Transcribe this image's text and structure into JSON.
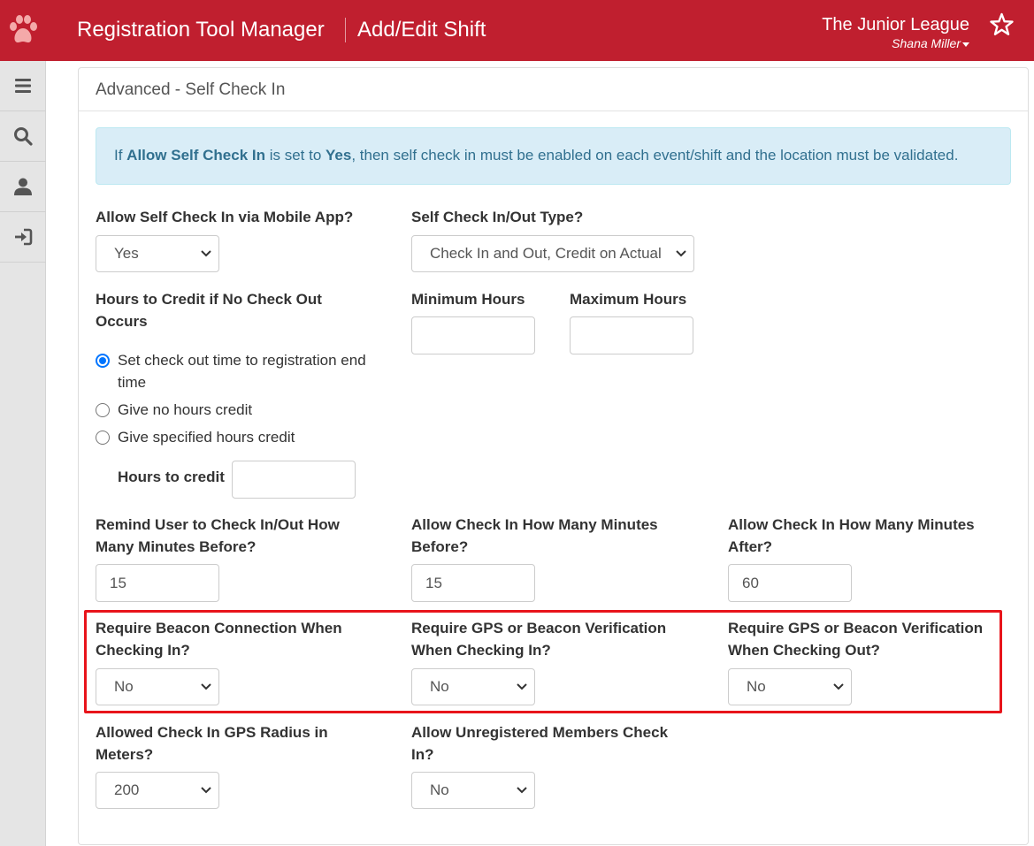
{
  "header": {
    "app_title": "Registration Tool Manager",
    "page_title": "Add/Edit Shift",
    "org_name": "The Junior League",
    "user_name": "Shana Miller",
    "brand_color": "#c01f2f",
    "logo_icon": "paw-icon",
    "favorite_icon": "star-icon"
  },
  "sidebar": {
    "items": [
      {
        "icon": "menu-icon"
      },
      {
        "icon": "search-icon"
      },
      {
        "icon": "user-icon"
      },
      {
        "icon": "sign-in-icon"
      }
    ]
  },
  "panel": {
    "title": "Advanced - Self Check In"
  },
  "alert": {
    "prefix": "If ",
    "strong1": "Allow Self Check In",
    "mid": " is set to ",
    "strong2": "Yes",
    "suffix": ", then self check in must be enabled on each event/shift and the location must be validated."
  },
  "form": {
    "allow_self_check_in": {
      "label": "Allow Self Check In via Mobile App?",
      "value": "Yes"
    },
    "check_type": {
      "label": "Self Check In/Out Type?",
      "value": "Check In and Out, Credit on Actual"
    },
    "hours_if_no_checkout": {
      "label": "Hours to Credit if No Check Out Occurs",
      "options": [
        {
          "label": "Set check out time to registration end time",
          "checked": true
        },
        {
          "label": "Give no hours credit",
          "checked": false
        },
        {
          "label": "Give specified hours credit",
          "checked": false
        }
      ],
      "hours_to_credit_label": "Hours to credit",
      "hours_to_credit_value": ""
    },
    "minimum_hours": {
      "label": "Minimum Hours",
      "value": ""
    },
    "maximum_hours": {
      "label": "Maximum Hours",
      "value": ""
    },
    "remind_minutes": {
      "label": "Remind User to Check In/Out How Many Minutes Before?",
      "value": "15"
    },
    "allow_minutes_before": {
      "label": "Allow Check In How Many Minutes Before?",
      "value": "15"
    },
    "allow_minutes_after": {
      "label": "Allow Check In How Many Minutes After?",
      "value": "60"
    },
    "require_beacon_in": {
      "label": "Require Beacon Connection When Checking In?",
      "value": "No"
    },
    "require_gps_in": {
      "label": "Require GPS or Beacon Verification When Checking In?",
      "value": "No"
    },
    "require_gps_out": {
      "label": "Require GPS or Beacon Verification When Checking Out?",
      "value": "No"
    },
    "gps_radius": {
      "label": "Allowed Check In GPS Radius in Meters?",
      "value": "200"
    },
    "allow_unregistered": {
      "label": "Allow Unregistered Members Check In?",
      "value": "No"
    }
  },
  "highlight_color": "#e8141b"
}
